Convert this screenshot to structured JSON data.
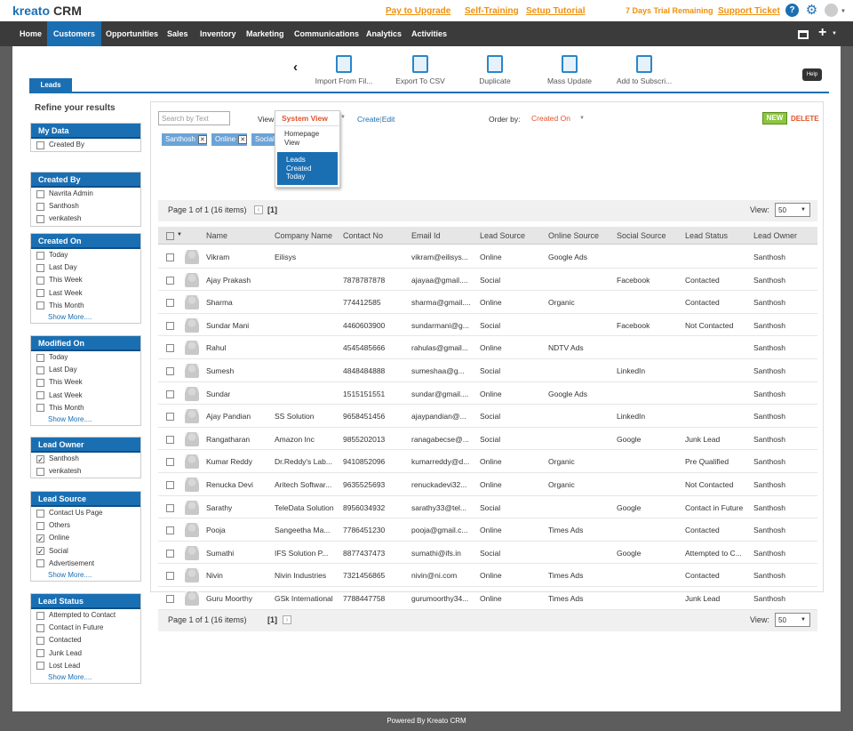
{
  "app": {
    "logo": "kreato",
    "logo_suffix": "CRM"
  },
  "top_links": [
    "Pay to Upgrade",
    "Self-Training",
    "Setup Tutorial"
  ],
  "trial_text": "7 Days Trial Remaining",
  "support_link": "Support Ticket",
  "nav": [
    "Home",
    "Customers",
    "Opportunities",
    "Sales",
    "Inventory",
    "Marketing",
    "Communications",
    "Analytics",
    "Activities"
  ],
  "nav_active": "Customers",
  "toolbar": [
    "Import From Fil...",
    "Export To CSV",
    "Duplicate",
    "Mass Update",
    "Add to Subscri..."
  ],
  "tab": "Leads",
  "help": "Help",
  "refine_title": "Refine your results",
  "filters": [
    {
      "title": "My Data",
      "items": [
        {
          "label": "Created By",
          "checked": false
        }
      ],
      "more": ""
    },
    {
      "title": "Created By",
      "items": [
        {
          "label": "Navrita Admin",
          "checked": false
        },
        {
          "label": "Santhosh",
          "checked": false
        },
        {
          "label": "venkatesh",
          "checked": false
        }
      ],
      "more": ""
    },
    {
      "title": "Created On",
      "items": [
        {
          "label": "Today",
          "checked": false
        },
        {
          "label": "Last Day",
          "checked": false
        },
        {
          "label": "This Week",
          "checked": false
        },
        {
          "label": "Last Week",
          "checked": false
        },
        {
          "label": "This Month",
          "checked": false
        }
      ],
      "more": "Show More...."
    },
    {
      "title": "Modified On",
      "items": [
        {
          "label": "Today",
          "checked": false
        },
        {
          "label": "Last Day",
          "checked": false
        },
        {
          "label": "This Week",
          "checked": false
        },
        {
          "label": "Last Week",
          "checked": false
        },
        {
          "label": "This Month",
          "checked": false
        }
      ],
      "more": "Show More...."
    },
    {
      "title": "Lead Owner",
      "items": [
        {
          "label": "Santhosh",
          "checked": true
        },
        {
          "label": "venkatesh",
          "checked": false
        }
      ],
      "more": ""
    },
    {
      "title": "Lead Source",
      "items": [
        {
          "label": "Contact Us Page",
          "checked": false
        },
        {
          "label": "Others",
          "checked": false
        },
        {
          "label": "Online",
          "checked": true
        },
        {
          "label": "Social",
          "checked": true
        },
        {
          "label": "Advertisement",
          "checked": false
        }
      ],
      "more": "Show More...."
    },
    {
      "title": "Lead Status",
      "items": [
        {
          "label": "Attempted to Contact",
          "checked": false
        },
        {
          "label": "Contact in Future",
          "checked": false
        },
        {
          "label": "Contacted",
          "checked": false
        },
        {
          "label": "Junk Lead",
          "checked": false
        },
        {
          "label": "Lost Lead",
          "checked": false
        }
      ],
      "more": "Show More...."
    }
  ],
  "search": {
    "placeholder": "Search by Text"
  },
  "view_label": "View",
  "view_dropdown": {
    "selected": "System View",
    "options": [
      "Homepage View",
      "Leads Created Today"
    ],
    "highlighted": "Leads Created Today"
  },
  "create_link": "Create",
  "edit_link": "Edit",
  "order_label": "Order by:",
  "order_value": "Created On",
  "new_button": "NEW",
  "delete_button": "DELETE",
  "chips": [
    "Santhosh",
    "Online",
    "Social"
  ],
  "pager": {
    "text": "Page 1 of 1 (16 items)",
    "current": "[1]",
    "view_label": "View:",
    "view_value": "50"
  },
  "columns": [
    "Name",
    "Company Name",
    "Contact No",
    "Email Id",
    "Lead Source",
    "Online Source",
    "Social Source",
    "Lead Status",
    "Lead Owner"
  ],
  "rows": [
    [
      "Vikram",
      "Eilisys",
      "",
      "vikram@eilisys...",
      "Online",
      "Google Ads",
      "",
      "",
      "Santhosh"
    ],
    [
      "Ajay Prakash",
      "",
      "7878787878",
      "ajayaa@gmail....",
      "Social",
      "",
      "Facebook",
      "Contacted",
      "Santhosh"
    ],
    [
      "Sharma",
      "",
      "774412585",
      "sharma@gmail....",
      "Online",
      "Organic",
      "",
      "Contacted",
      "Santhosh"
    ],
    [
      "Sundar Mani",
      "",
      "4460603900",
      "sundarmani@g...",
      "Social",
      "",
      "Facebook",
      "Not Contacted",
      "Santhosh"
    ],
    [
      "Rahul",
      "",
      "4545485666",
      "rahulas@gmail...",
      "Online",
      "NDTV Ads",
      "",
      "",
      "Santhosh"
    ],
    [
      "Sumesh",
      "",
      "4848484888",
      "sumeshaa@g...",
      "Social",
      "",
      "LinkedIn",
      "",
      "Santhosh"
    ],
    [
      "Sundar",
      "",
      "1515151551",
      "sundar@gmail....",
      "Online",
      "Google Ads",
      "",
      "",
      "Santhosh"
    ],
    [
      "Ajay Pandian",
      "SS Solution",
      "9658451456",
      "ajaypandian@...",
      "Social",
      "",
      "LinkedIn",
      "",
      "Santhosh"
    ],
    [
      "Rangatharan",
      "Amazon Inc",
      "9855202013",
      "ranagabecse@...",
      "Social",
      "",
      "Google",
      "Junk Lead",
      "Santhosh"
    ],
    [
      "Kumar Reddy",
      "Dr.Reddy's Lab...",
      "9410852096",
      "kumarreddy@d...",
      "Online",
      "Organic",
      "",
      "Pre Qualified",
      "Santhosh"
    ],
    [
      "Renucka Devi",
      "Aritech Softwar...",
      "9635525693",
      "renuckadevi32...",
      "Online",
      "Organic",
      "",
      "Not Contacted",
      "Santhosh"
    ],
    [
      "Sarathy",
      "TeleData Solution",
      "8956034932",
      "sarathy33@tel...",
      "Social",
      "",
      "Google",
      "Contact in Future",
      "Santhosh"
    ],
    [
      "Pooja",
      "Sangeetha Ma...",
      "7786451230",
      "pooja@gmail.c...",
      "Online",
      "Times Ads",
      "",
      "Contacted",
      "Santhosh"
    ],
    [
      "Sumathi",
      "IFS Solution P...",
      "8877437473",
      "sumathi@ifs.in",
      "Social",
      "",
      "Google",
      "Attempted to C...",
      "Santhosh"
    ],
    [
      "Nivin",
      "Nivin Industries",
      "7321456865",
      "nivin@ni.com",
      "Online",
      "Times Ads",
      "",
      "Contacted",
      "Santhosh"
    ],
    [
      "Guru Moorthy",
      "GSk International",
      "7788447758",
      "gurumoorthy34...",
      "Online",
      "Times Ads",
      "",
      "Junk Lead",
      "Santhosh"
    ]
  ],
  "footer": "Powered By Kreato CRM",
  "colors": {
    "brand": "#1a6fb3",
    "accent": "#f0900c",
    "nav_bg": "#3b3b3b",
    "new_green": "#8cc63f",
    "delete_red": "#e0522b"
  }
}
